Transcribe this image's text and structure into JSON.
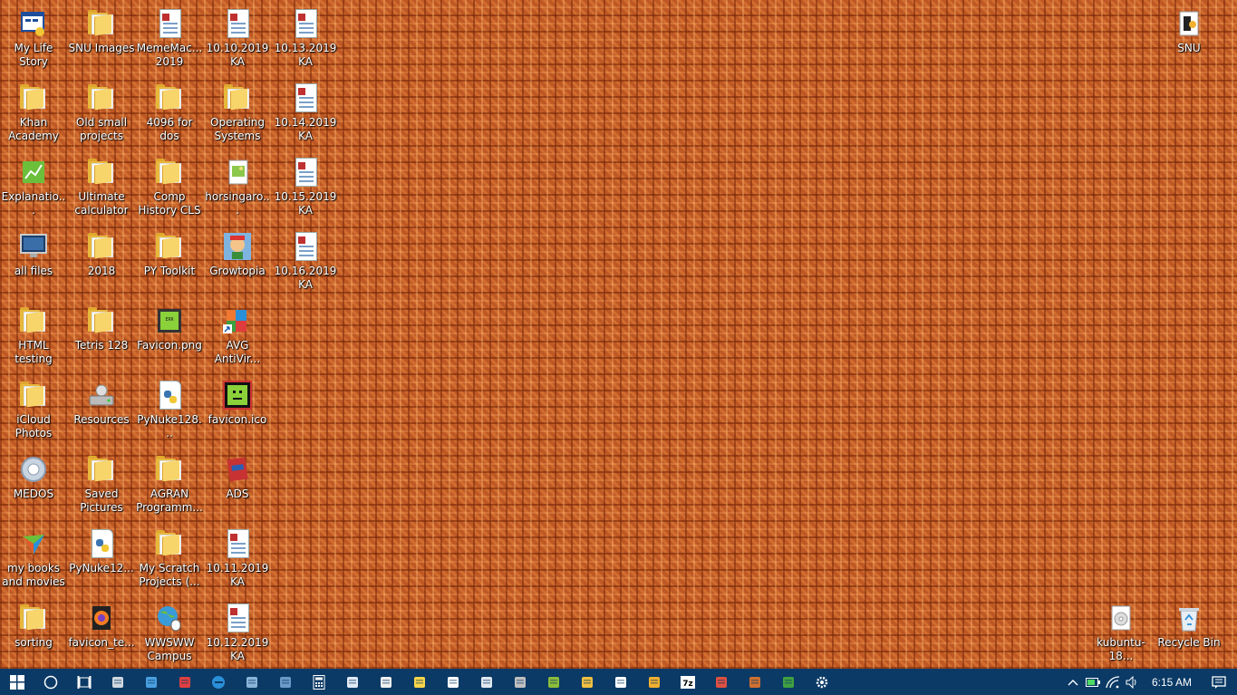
{
  "desktop": {
    "icons": [
      {
        "label": "My Life Story",
        "icon": "app-window-icon"
      },
      {
        "label": "SNU Images",
        "icon": "folder-icon"
      },
      {
        "label": "MemeMac... 2019",
        "icon": "document-icon"
      },
      {
        "label": "10.10.2019 KA",
        "icon": "document-icon"
      },
      {
        "label": "10.13.2019 KA",
        "icon": "document-icon"
      },
      {
        "label": "Khan Academy",
        "icon": "folder-icon"
      },
      {
        "label": "Old small projects",
        "icon": "folder-icon"
      },
      {
        "label": "4096 for dos",
        "icon": "folder-icon"
      },
      {
        "label": "Operating Systems",
        "icon": "folder-icon"
      },
      {
        "label": "10.14.2019 KA",
        "icon": "document-icon"
      },
      {
        "label": "Explanatio...",
        "icon": "chart-app-icon"
      },
      {
        "label": "Ultimate calculator",
        "icon": "folder-icon"
      },
      {
        "label": "Comp History CLS",
        "icon": "folder-icon"
      },
      {
        "label": "horsingaro...",
        "icon": "image-file-icon"
      },
      {
        "label": "10.15.2019 KA",
        "icon": "document-icon"
      },
      {
        "label": "all files",
        "icon": "monitor-icon"
      },
      {
        "label": "2018",
        "icon": "folder-icon"
      },
      {
        "label": "PY Toolkit",
        "icon": "folder-icon"
      },
      {
        "label": "Growtopia",
        "icon": "game-character-icon"
      },
      {
        "label": "10.16.2019 KA",
        "icon": "document-icon"
      },
      {
        "label": "HTML testing",
        "icon": "folder-icon"
      },
      {
        "label": "Tetris 128",
        "icon": "folder-icon"
      },
      {
        "label": "Favicon.png",
        "icon": "green-image-icon"
      },
      {
        "label": "AVG AntiVir...",
        "icon": "avg-shortcut-icon"
      },
      {
        "label": "iCloud Photos",
        "icon": "folder-icon"
      },
      {
        "label": "Resources",
        "icon": "drive-icon"
      },
      {
        "label": "PyNuke128...",
        "icon": "python-file-icon"
      },
      {
        "label": "favicon.ico",
        "icon": "green-face-icon"
      },
      {
        "label": "MEDOS",
        "icon": "gear-disc-icon"
      },
      {
        "label": "Saved Pictures",
        "icon": "folder-icon"
      },
      {
        "label": "AGRAN Programm...",
        "icon": "folder-icon"
      },
      {
        "label": "ADS",
        "icon": "red-book-icon"
      },
      {
        "label": "my books and movies",
        "icon": "media-player-icon"
      },
      {
        "label": "PyNuke12...",
        "icon": "python-file-icon"
      },
      {
        "label": "My Scratch Projects (...",
        "icon": "folder-icon"
      },
      {
        "label": "10.11.2019 KA",
        "icon": "document-icon"
      },
      {
        "label": "sorting",
        "icon": "folder-icon"
      },
      {
        "label": "favicon_te...",
        "icon": "firefox-file-icon"
      },
      {
        "label": "WWSWW Campus",
        "icon": "globe-mouse-icon"
      },
      {
        "label": "10.12.2019 KA",
        "icon": "document-icon"
      },
      {
        "label": "SNU",
        "icon": "audio-file-icon"
      },
      {
        "label": "kubuntu-18...",
        "icon": "disc-image-icon"
      },
      {
        "label": "Recycle Bin",
        "icon": "recycle-bin-icon"
      }
    ]
  },
  "taskbar": {
    "start": "start-windows-icon",
    "search": "cortana-circle-icon",
    "task_view": "task-view-icon",
    "pinned": [
      "this-pc-icon",
      "app-settings-icon",
      "media-app-icon",
      "edge-browser-icon",
      "remote-desktop-icon",
      "network-cloud-icon",
      "calculator-icon",
      "notepad-icon",
      "document-app-icon",
      "sticky-note-icon",
      "photos-app-icon",
      "paint-app-icon",
      "game-app-icon",
      "mango-app-icon",
      "screen-tool-icon",
      "settings-tool-icon",
      "file-manager-icon",
      "archive-7z-icon",
      "image-editor-icon",
      "books-app-icon",
      "library-app-icon",
      "settings-gear-icon"
    ],
    "tray": {
      "chevron": "chevron-up-icon",
      "battery": "battery-icon",
      "wifi": "wifi-icon",
      "volume": "volume-icon",
      "time": "6:15 AM",
      "notifications": "action-center-icon"
    }
  },
  "colors": {
    "taskbar": "#0b3a66",
    "wallpaper": "#c8622a",
    "folder": "#f8d56b"
  }
}
